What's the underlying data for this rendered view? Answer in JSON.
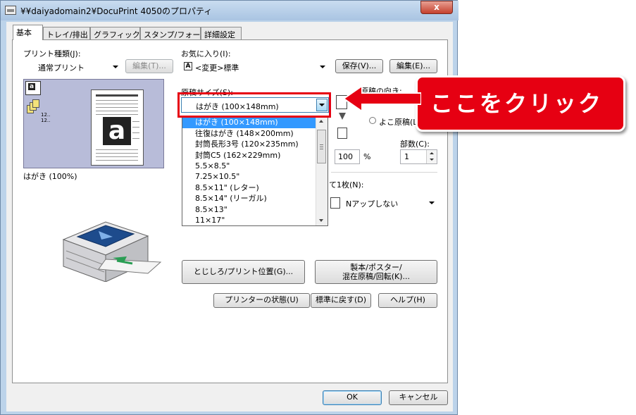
{
  "window": {
    "title": "¥¥daiyadomain2¥DocuPrint 4050のプロパティ",
    "close_label": "x"
  },
  "tabs": [
    {
      "label": "基本",
      "selected": true
    },
    {
      "label": "トレイ/排出"
    },
    {
      "label": "グラフィックス"
    },
    {
      "label": "スタンプ/フォーム"
    },
    {
      "label": "詳細設定"
    }
  ],
  "print_type": {
    "label": "プリント種類(J):",
    "value": "通常プリント",
    "edit_label": "編集(T)..."
  },
  "favorites": {
    "label": "お気に入り(I):",
    "icon_letter": "A",
    "value": "<変更>標準",
    "save_label": "保存(V)...",
    "edit_label": "編集(E)..."
  },
  "preview": {
    "caption": "はがき (100%)",
    "big_letter": "a",
    "mini_labels": [
      "12..",
      "12.."
    ]
  },
  "paper_size": {
    "label": "原稿サイズ(S):",
    "value": "はがき (100×148mm)",
    "options": [
      "はがき (100×148mm)",
      "往復はがき (148×200mm)",
      "封筒長形3号 (120×235mm)",
      "封筒C5 (162×229mm)",
      "5.5×8.5\"",
      "7.25×10.5\"",
      "8.5×11\" (レター)",
      "8.5×14\" (リーガル)",
      "8.5×13\"",
      "11×17\""
    ],
    "selected_index": 0
  },
  "orientation": {
    "label": "原稿の向き:",
    "landscape_label": "よこ原稿(L"
  },
  "zoom": {
    "value": "100",
    "unit": "%"
  },
  "copies": {
    "label": "部数(C):",
    "value": "1"
  },
  "nup": {
    "label": "て1枚(N):",
    "value": "Nアップしない"
  },
  "buttons": {
    "binding": "とじしろ/プリント位置(G)...",
    "booklet_line1": "製本/ポスター/",
    "booklet_line2": "混在原稿/回転(K)...",
    "printer_status": "プリンターの状態(U)",
    "reset_default": "標準に戻す(D)",
    "help": "ヘルプ(H)",
    "ok": "OK",
    "cancel": "キャンセル"
  },
  "callout": {
    "text": "ここをクリック"
  },
  "colors": {
    "accent_red": "#e60012",
    "selection_blue": "#3399ff",
    "preview_bg": "#b8bcd9"
  }
}
